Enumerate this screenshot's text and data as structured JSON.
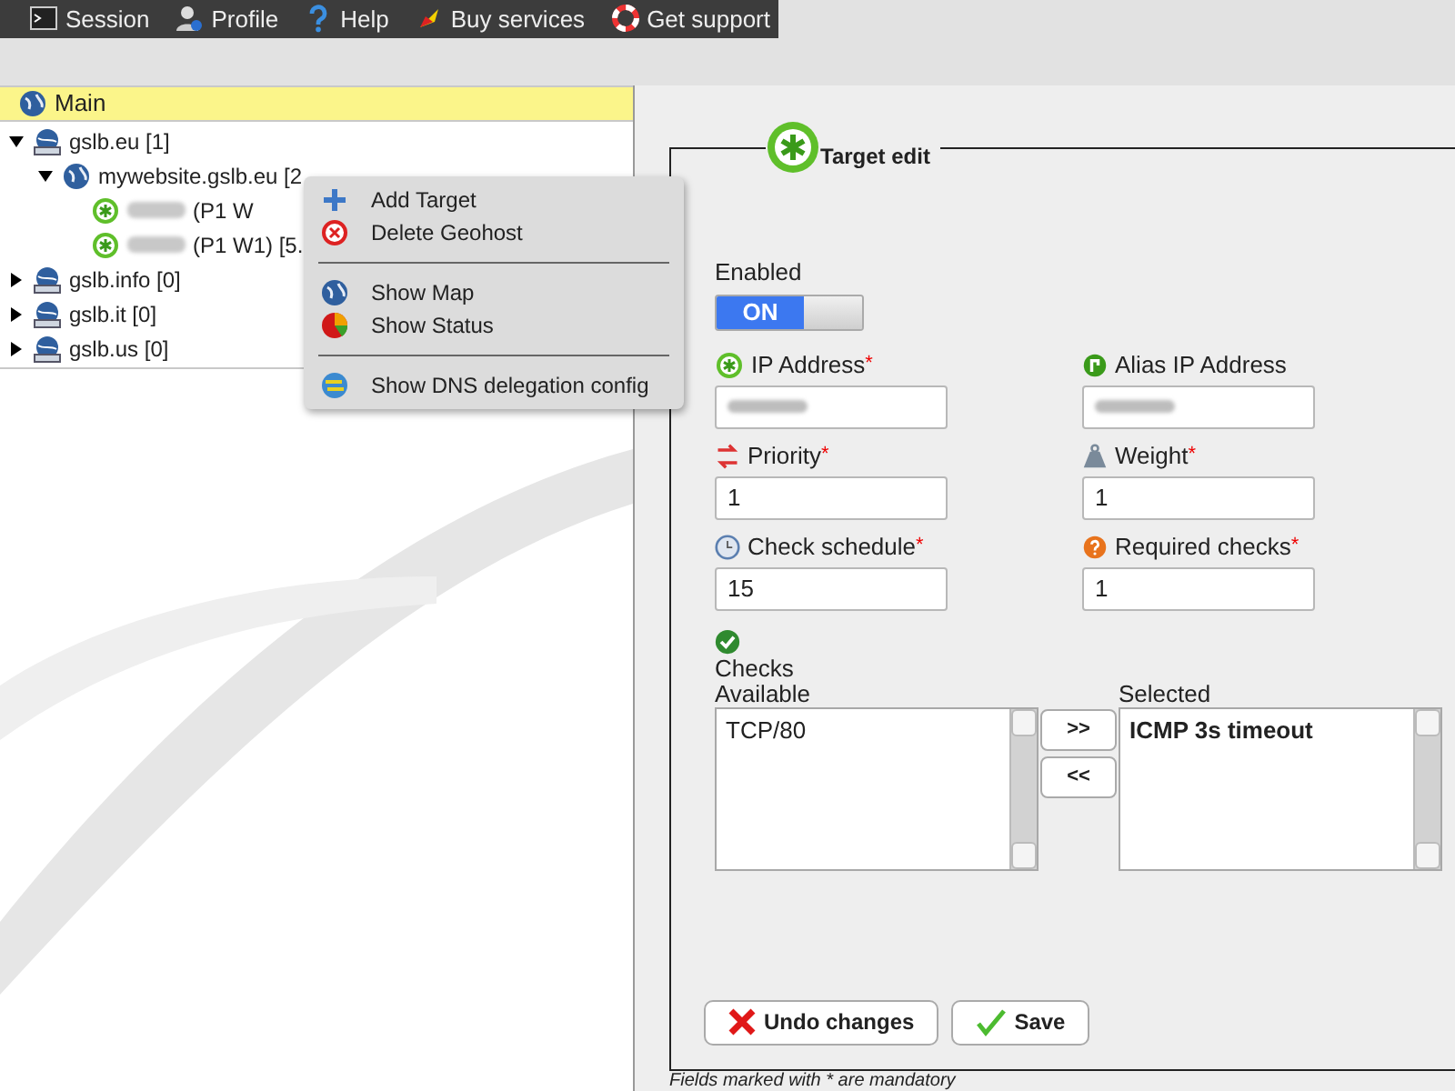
{
  "top_menu": [
    {
      "label": "Session",
      "kind": "terminal"
    },
    {
      "label": "Profile",
      "kind": "user"
    },
    {
      "label": "Help",
      "kind": "help"
    },
    {
      "label": "Buy services",
      "kind": "rocket"
    },
    {
      "label": "Get support",
      "kind": "lifebuoy"
    }
  ],
  "tree": {
    "title": "Main",
    "nodes": [
      {
        "kind": "domain",
        "label": "gslb.eu [1]",
        "expanded": true,
        "children": [
          {
            "kind": "geohost",
            "label": "mywebsite.gslb.eu [2",
            "expanded": true,
            "children": [
              {
                "kind": "target",
                "label": "(P1 W",
                "redacted": true
              },
              {
                "kind": "target",
                "label": "(P1 W1) [5.",
                "redacted": true
              }
            ]
          }
        ]
      },
      {
        "kind": "domain",
        "label": "gslb.info [0]",
        "expanded": false
      },
      {
        "kind": "domain",
        "label": "gslb.it [0]",
        "expanded": false
      },
      {
        "kind": "domain",
        "label": "gslb.us [0]",
        "expanded": false
      }
    ]
  },
  "context_menu": [
    {
      "kind": "add",
      "label": "Add Target"
    },
    {
      "kind": "delete",
      "label": "Delete Geohost"
    },
    {
      "kind": "separator"
    },
    {
      "kind": "map",
      "label": "Show Map"
    },
    {
      "kind": "status",
      "label": "Show Status"
    },
    {
      "kind": "separator"
    },
    {
      "kind": "dns",
      "label": "Show DNS delegation config"
    }
  ],
  "form": {
    "title": "Target edit",
    "enabled": {
      "label": "Enabled",
      "on": true,
      "on_text": "ON"
    },
    "fields": [
      {
        "kind": "target",
        "label": "IP Address",
        "required": true,
        "redacted": true
      },
      {
        "kind": "alias",
        "label": "Alias IP Address",
        "required": false,
        "redacted": true
      },
      {
        "kind": "priority",
        "label": "Priority",
        "required": true,
        "value": "1"
      },
      {
        "kind": "weight",
        "label": "Weight",
        "required": true,
        "value": "1"
      },
      {
        "kind": "clock",
        "label": "Check schedule",
        "required": true,
        "value": "15"
      },
      {
        "kind": "question",
        "label": "Required checks",
        "required": true,
        "value": "1"
      }
    ],
    "checks": {
      "label": "Checks",
      "available_label": "Available",
      "available": [
        "TCP/80"
      ],
      "selected_label": "Selected",
      "selected": [
        "ICMP 3s timeout"
      ],
      "add_button": ">>",
      "remove_button": "<<"
    },
    "actions": [
      {
        "kind": "undo",
        "label": "Undo changes"
      },
      {
        "kind": "save",
        "label": "Save"
      }
    ],
    "required_mark": "*",
    "footnote": "Fields marked with * are mandatory"
  }
}
